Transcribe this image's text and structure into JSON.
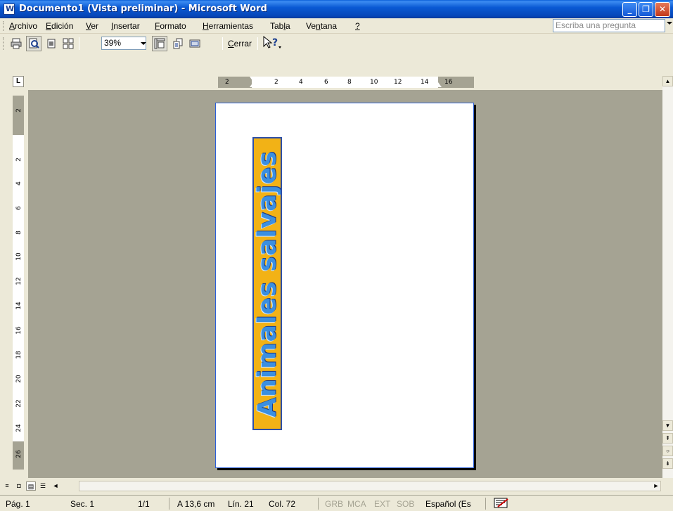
{
  "window": {
    "title": "Documento1 (Vista preliminar) - Microsoft Word",
    "min_glyph": "_",
    "max_glyph": "❐",
    "close_glyph": "✕"
  },
  "menu": {
    "items": [
      {
        "pre": "",
        "u": "A",
        "post": "rchivo"
      },
      {
        "pre": "",
        "u": "E",
        "post": "dición"
      },
      {
        "pre": "",
        "u": "V",
        "post": "er"
      },
      {
        "pre": "",
        "u": "I",
        "post": "nsertar"
      },
      {
        "pre": "",
        "u": "F",
        "post": "ormato"
      },
      {
        "pre": "",
        "u": "H",
        "post": "erramientas"
      },
      {
        "pre": "Tab",
        "u": "l",
        "post": "a"
      },
      {
        "pre": "Ve",
        "u": "n",
        "post": "tana"
      },
      {
        "pre": "",
        "u": "?",
        "post": ""
      }
    ],
    "ask_placeholder": "Escriba una pregunta"
  },
  "toolbar": {
    "print_icon": "print-icon",
    "magnifier_icon": "magnifier-icon",
    "one_page_icon": "one-page-icon",
    "multi_page_icon": "multiple-pages-icon",
    "zoom_value": "39%",
    "ruler_icon": "view-ruler-icon",
    "shrink_icon": "shrink-to-fit-icon",
    "fullscreen_icon": "full-screen-icon",
    "close_label_u": "C",
    "close_label_rest": "errar",
    "help_icon": "context-help-icon"
  },
  "ruler": {
    "corner": "L",
    "h_numbers": [
      "2",
      "2",
      "4",
      "6",
      "8",
      "10",
      "12",
      "14",
      "16"
    ],
    "v_numbers": [
      "2",
      "2",
      "4",
      "6",
      "8",
      "10",
      "12",
      "14",
      "16",
      "18",
      "20",
      "22",
      "24",
      "26"
    ]
  },
  "document": {
    "wordart_text": "Animales salvajes"
  },
  "status": {
    "page": "Pág. 1",
    "section": "Sec. 1",
    "pages": "1/1",
    "at": "A 13,6 cm",
    "line": "Lín. 21",
    "col": "Col. 72",
    "grb": "GRB",
    "mca": "MCA",
    "ext": "EXT",
    "sob": "SOB",
    "language": "Español (Es",
    "spelling_icon": "spelling-check-icon"
  },
  "colors": {
    "titlebar": "#0a5ad4",
    "wordart_fill": "#f2b216",
    "wordart_text": "#3b8fe0",
    "workspace": "#a5a393"
  }
}
